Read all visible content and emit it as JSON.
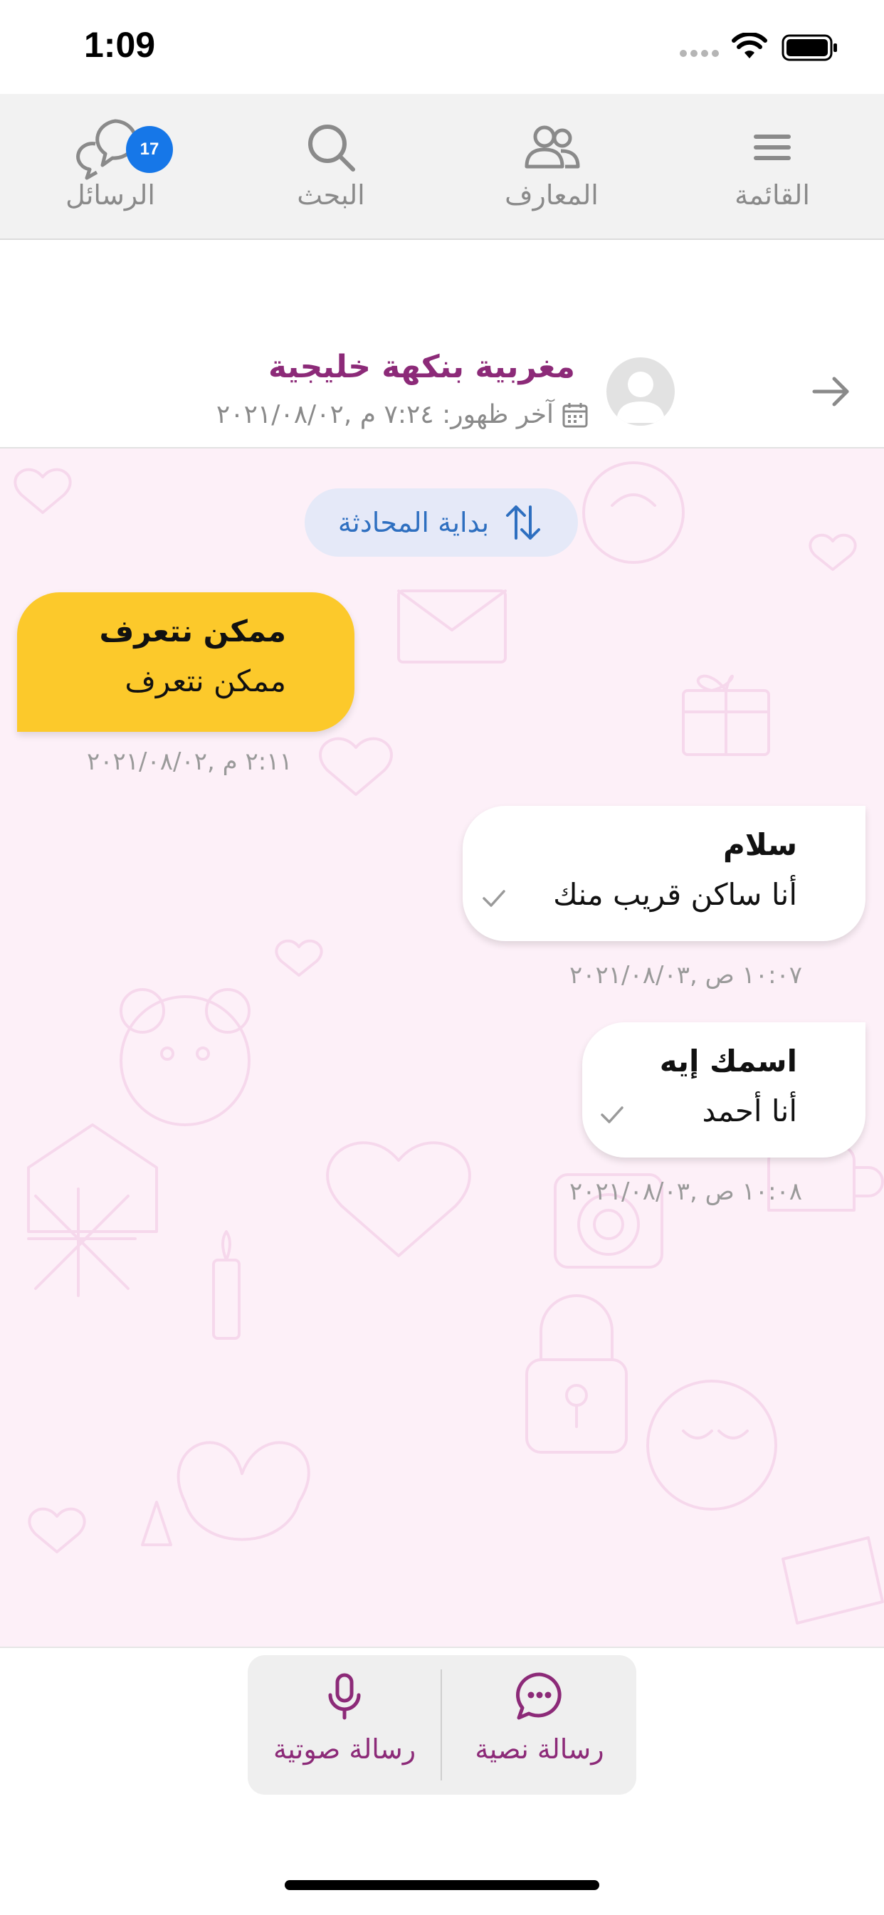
{
  "status": {
    "time": "1:09"
  },
  "nav": {
    "menu_label": "القائمة",
    "contacts_label": "المعارف",
    "search_label": "البحث",
    "messages_label": "الرسائل",
    "messages_badge": "17"
  },
  "header": {
    "contact_name": "مغربية بنكهة خليجية",
    "last_seen": "آخر ظهور: ٧:٢٤ م ,٢٠٢١/٠٨/٠٢"
  },
  "chat": {
    "start_label": "بداية المحادثة",
    "messages": [
      {
        "direction": "in",
        "title": "ممكن نتعرف",
        "body": "ممكن نتعرف",
        "time": "٢:١١ م ,٢٠٢١/٠٨/٠٢"
      },
      {
        "direction": "out",
        "title": "سلام",
        "body": "أنا ساكن قريب منك",
        "time": "١٠:٠٧ ص ,٢٠٢١/٠٨/٠٣"
      },
      {
        "direction": "out",
        "title": "اسمك إيه",
        "body": "أنا أحمد",
        "time": "١٠:٠٨ ص ,٢٠٢١/٠٨/٠٣"
      }
    ]
  },
  "compose": {
    "text_label": "رسالة نصية",
    "voice_label": "رسالة صوتية"
  },
  "colors": {
    "brand": "#8c2a78",
    "incoming_bubble": "#fcc92b",
    "badge": "#1677e8",
    "chat_background": "#fdf0f8"
  }
}
